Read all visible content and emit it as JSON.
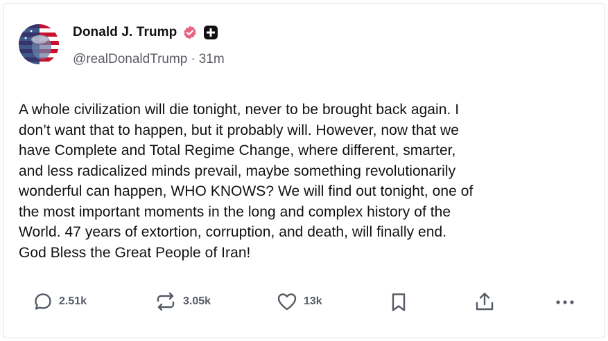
{
  "post": {
    "author": {
      "display_name": "Donald J. Trump",
      "handle": "@realDonaldTrump",
      "separator": "·",
      "time_ago": "31m",
      "verified_icon": "verified-badge-icon",
      "extra_badge_icon": "plus-badge-icon"
    },
    "text": "A whole civilization will die tonight, never to be brought back again. I\ndon’t want that to happen, but it probably will. However, now that we\nhave Complete and Total Regime Change, where different, smarter,\nand less radicalized minds prevail, maybe something revolutionarily\nwonderful can happen, WHO KNOWS? We will find out tonight, one of\nthe most important moments in the long and complex history of the\nWorld. 47 years of extortion, corruption, and death, will finally end.\nGod Bless the Great People of Iran!",
    "actions": {
      "replies": "2.51k",
      "reposts": "3.05k",
      "likes": "13k"
    }
  },
  "colors": {
    "verified": "#e8637f",
    "icon": "#555b66",
    "text": "#111111",
    "muted": "#5b5b66"
  }
}
